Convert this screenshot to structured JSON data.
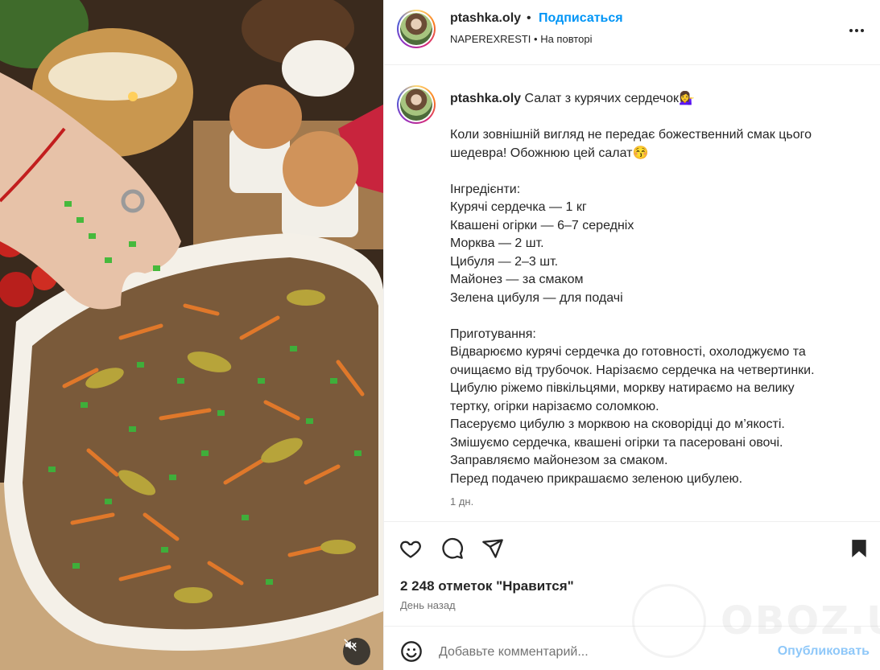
{
  "header": {
    "username": "ptashka.oly",
    "separator": "•",
    "follow_label": "Подписаться",
    "subline": "NAPEREXRESTI • На повторі"
  },
  "caption": {
    "username": "ptashka.oly",
    "title": "Салат з курячих сердечок💁‍♀️",
    "intro": [
      "Коли зовнішній вигляд не передає божественний смак цього",
      "шедевра! Обожнюю цей салат😚"
    ],
    "ingredients_heading": "Інгредієнти:",
    "ingredients": [
      "Курячі сердечка — 1 кг",
      "Квашені огірки — 6–7 середніх",
      "Морква — 2 шт.",
      "Цибуля — 2–3 шт.",
      "Майонез — за смаком",
      "Зелена цибуля — для подачі"
    ],
    "steps_heading": "Приготування:",
    "steps": [
      "Відварюємо курячі сердечка до готовності, охолоджуємо та",
      "очищаємо від трубочок. Нарізаємо сердечка на четвертинки.",
      "Цибулю ріжемо півкільцями, моркву натираємо на велику",
      "тертку, огірки нарізаємо соломкою.",
      "Пасеруємо цибулю з морквою на сковорідці до м’якості.",
      "Змішуємо сердечка, квашені огірки та пасеровані овочі.",
      "Заправляємо майонезом за смаком.",
      "Перед подачею прикрашаємо зеленою цибулею."
    ],
    "time_ago": "1 дн."
  },
  "actions": {
    "like_icon": "heart-icon",
    "comment_icon": "comment-icon",
    "share_icon": "share-icon",
    "save_icon": "bookmark-icon"
  },
  "likes_text": "2 248 отметок \"Нравится\"",
  "date_text": "День назад",
  "comment": {
    "placeholder": "Добавьте комментарий...",
    "publish_label": "Опубликовать"
  },
  "watermark": {
    "text": "OBOZ.UA"
  },
  "colors": {
    "accent": "#0095f6",
    "publish_disabled": "#8fc8f9",
    "text": "#262626",
    "muted": "#737373"
  }
}
